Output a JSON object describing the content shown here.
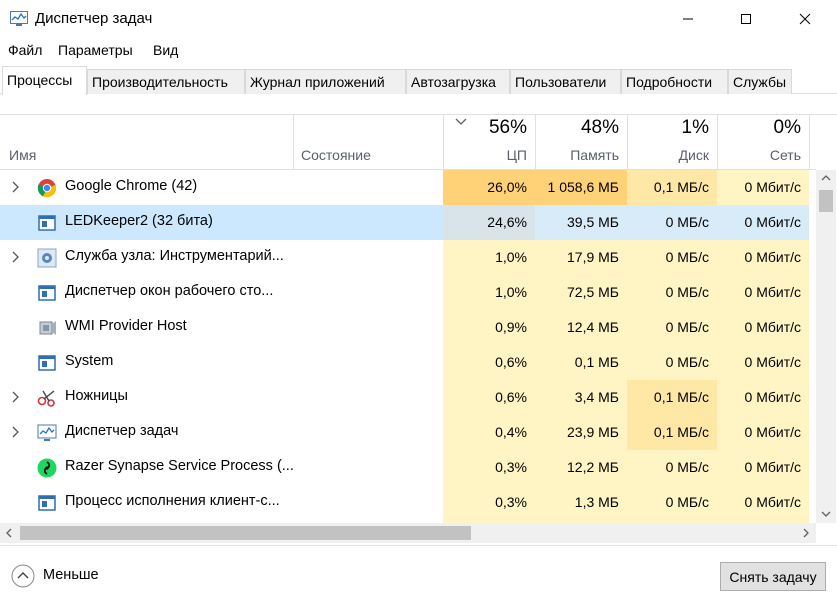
{
  "window": {
    "title": "Диспетчер задач"
  },
  "menu": [
    "Файл",
    "Параметры",
    "Вид"
  ],
  "tabs": [
    "Процессы",
    "Производительность",
    "Журнал приложений",
    "Автозагрузка",
    "Пользователи",
    "Подробности",
    "Службы"
  ],
  "active_tab": "Процессы",
  "columns": {
    "name": "Имя",
    "state": "Состояние",
    "cpu": {
      "percent": "56%",
      "label": "ЦП"
    },
    "memory": {
      "percent": "48%",
      "label": "Память"
    },
    "disk": {
      "percent": "1%",
      "label": "Диск"
    },
    "network": {
      "percent": "0%",
      "label": "Сеть"
    }
  },
  "rows": [
    {
      "name": "Google Chrome (42)",
      "icon": "chrome-icon",
      "expandable": true,
      "cpu": "26,0%",
      "mem": "1 058,6 МБ",
      "disk": "0,1 МБ/с",
      "net": "0 Мбит/с"
    },
    {
      "name": "LEDKeeper2 (32 бита)",
      "icon": "app-window-icon",
      "expandable": false,
      "selected": true,
      "cpu": "24,6%",
      "mem": "39,5 МБ",
      "disk": "0 МБ/с",
      "net": "0 Мбит/с"
    },
    {
      "name": "Служба узла: Инструментарий...",
      "icon": "service-gear-icon",
      "expandable": true,
      "cpu": "1,0%",
      "mem": "17,9 МБ",
      "disk": "0 МБ/с",
      "net": "0 Мбит/с"
    },
    {
      "name": "Диспетчер окон рабочего сто...",
      "icon": "app-window-icon",
      "expandable": false,
      "cpu": "1,0%",
      "mem": "72,5 МБ",
      "disk": "0 МБ/с",
      "net": "0 Мбит/с"
    },
    {
      "name": "WMI Provider Host",
      "icon": "wmi-icon",
      "expandable": false,
      "cpu": "0,9%",
      "mem": "12,4 МБ",
      "disk": "0 МБ/с",
      "net": "0 Мбит/с"
    },
    {
      "name": "System",
      "icon": "app-window-icon",
      "expandable": false,
      "cpu": "0,6%",
      "mem": "0,1 МБ",
      "disk": "0 МБ/с",
      "net": "0 Мбит/с"
    },
    {
      "name": "Ножницы",
      "icon": "scissors-icon",
      "expandable": true,
      "cpu": "0,6%",
      "mem": "3,4 МБ",
      "disk": "0,1 МБ/с",
      "net": "0 Мбит/с"
    },
    {
      "name": "Диспетчер задач",
      "icon": "task-manager-icon",
      "expandable": true,
      "cpu": "0,4%",
      "mem": "23,9 МБ",
      "disk": "0,1 МБ/с",
      "net": "0 Мбит/с"
    },
    {
      "name": "Razer Synapse Service Process (...",
      "icon": "razer-icon",
      "expandable": false,
      "cpu": "0,3%",
      "mem": "12,2 МБ",
      "disk": "0 МБ/с",
      "net": "0 Мбит/с"
    },
    {
      "name": "Процесс исполнения клиент-с...",
      "icon": "app-window-icon",
      "expandable": false,
      "cpu": "0,3%",
      "mem": "1,3 МБ",
      "disk": "0 МБ/с",
      "net": "0 Мбит/с"
    }
  ],
  "colors": {
    "heat_high": "#ffd278",
    "heat_mid": "#ffe8a6",
    "heat_low": "#fff4c4",
    "selection": "#cce8ff"
  },
  "footer": {
    "fewer_details": "Меньше",
    "end_task": "Снять задачу"
  }
}
